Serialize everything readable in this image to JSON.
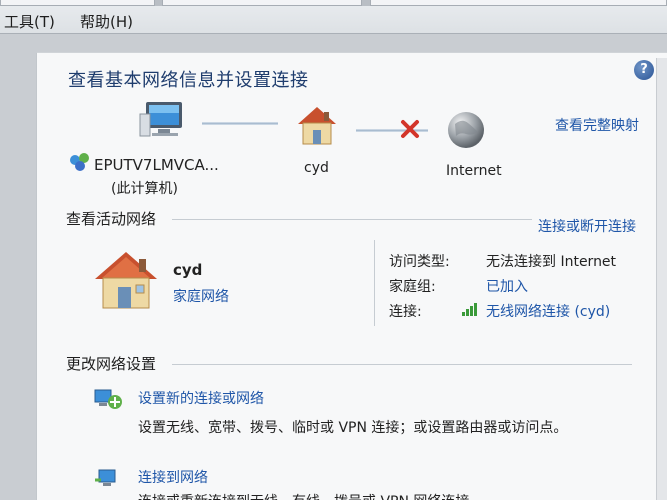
{
  "menu": {
    "tools": "工具(T)",
    "help": "帮助(H)"
  },
  "page": {
    "title": "查看基本网络信息并设置连接",
    "view_full_map": "查看完整映射"
  },
  "map": {
    "computer_name": "EPUTV7LMVCA...",
    "computer_sub": "(此计算机)",
    "network_name": "cyd",
    "internet": "Internet"
  },
  "active": {
    "title": "查看活动网络",
    "connect_link": "连接或断开连接",
    "network_name": "cyd",
    "network_type": "家庭网络",
    "access_type_label": "访问类型:",
    "access_type_value": "无法连接到 Internet",
    "homegroup_label": "家庭组:",
    "homegroup_value": "已加入",
    "connection_label": "连接:",
    "connection_value": "无线网络连接 (cyd)"
  },
  "change": {
    "title": "更改网络设置",
    "items": [
      {
        "label": "设置新的连接或网络",
        "desc": "设置无线、宽带、拨号、临时或 VPN 连接；或设置路由器或访问点。"
      },
      {
        "label": "连接到网络",
        "desc": "连接或重新连接到无线、有线、拨号或 VPN 网络连接。"
      }
    ]
  },
  "colors": {
    "link": "#1f56a8",
    "title": "#1f3d6e",
    "error": "#d3352a"
  }
}
